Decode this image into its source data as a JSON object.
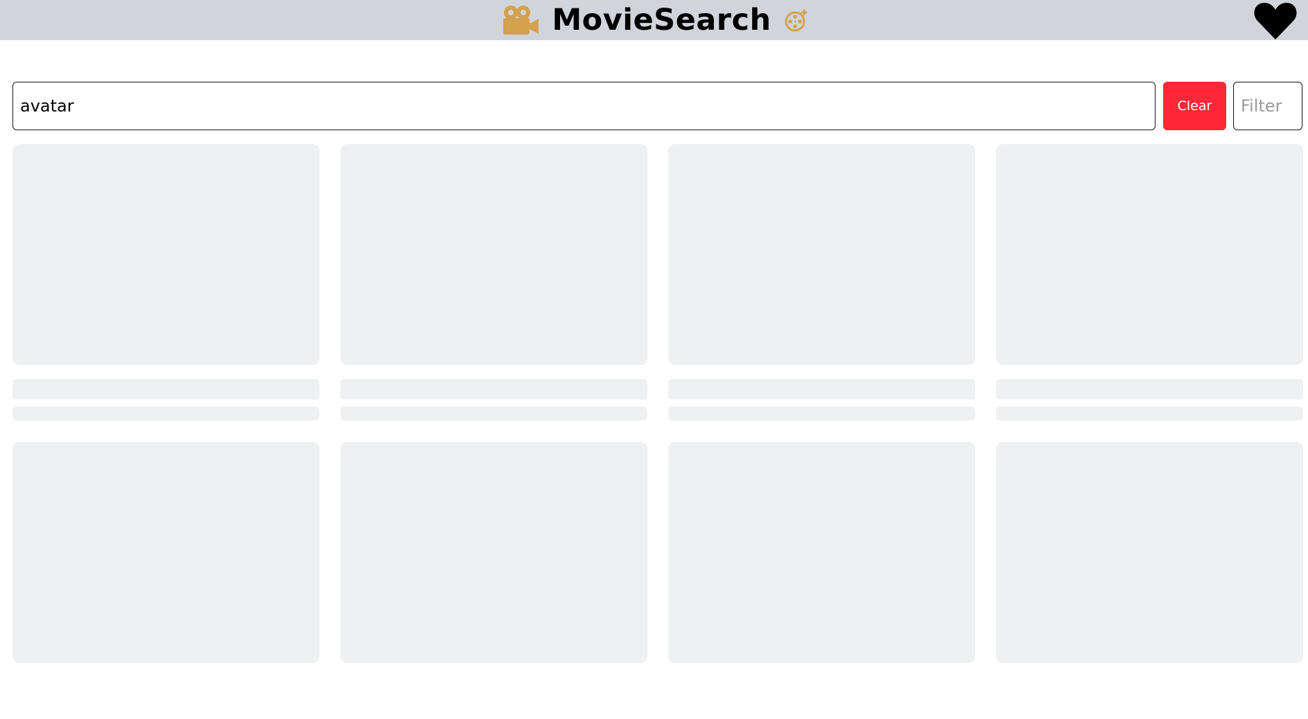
{
  "header": {
    "title": "MovieSearch",
    "left_icon": "movie-camera-icon",
    "right_icon": "film-reel-sparkle-icon",
    "accent_color": "#d4a24c",
    "background_color": "#d1d5db"
  },
  "favorites": {
    "icon": "heart-icon",
    "color": "#000000"
  },
  "search": {
    "value": "avatar",
    "clear_label": "Clear",
    "clear_color": "#ff2738",
    "filter_placeholder": "Filter"
  },
  "results": {
    "state": "loading",
    "skeleton_color": "#eff0f2"
  }
}
